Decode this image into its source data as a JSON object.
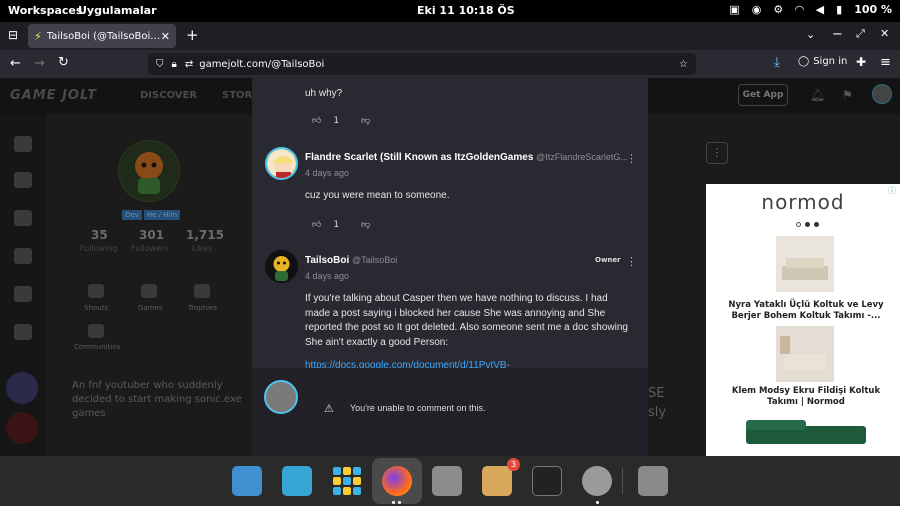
{
  "topbar": {
    "workspaces": "Workspaces",
    "apps": "Uygulamalar",
    "clock": "Eki 11  10:18 ÖS",
    "battery": "100 %"
  },
  "browser": {
    "tab_title": "TailsoBoi (@TailsoBoi) - Ga",
    "url": "gamejolt.com/@TailsoBoi",
    "signin": "Sign in"
  },
  "gamejolt": {
    "logo": "GAME JOLT",
    "discover": "DISCOVER",
    "store": "STOR",
    "get_app": "Get App",
    "tags": [
      "Dev",
      "He / Him"
    ],
    "stats": [
      {
        "value": "35",
        "label": "Following"
      },
      {
        "value": "301",
        "label": "Followers"
      },
      {
        "value": "1,715",
        "label": "Likes"
      }
    ],
    "tabs": [
      "Shouts",
      "Games",
      "Trophies",
      "Communities"
    ],
    "bio": "An fnf youtuber who suddenly decided to start making sonic.exe games",
    "side_text": [
      "SE",
      "sly"
    ]
  },
  "ad": {
    "brand": "normod",
    "items": [
      {
        "title": "Nyra Yataklı Üçlü Koltuk ve Levy Berjer Bohem Koltuk Takımı -..."
      },
      {
        "title": "Klem Modsy Ekru Fildişi Koltuk Takımı | Normod"
      }
    ]
  },
  "comments": {
    "items": [
      {
        "text": "uh why?",
        "likes": "1"
      },
      {
        "name": "Flandre Scarlet (Still Known as ItzGoldenGames",
        "handle": "@ItzFlandreScarletG...",
        "date": "4 days ago",
        "text": "cuz you were mean to someone.",
        "likes": "1"
      },
      {
        "name": "TailsoBoi",
        "handle": "@TailsoBoi",
        "badge": "Owner",
        "date": "4 days ago",
        "text": "If you're talking about Casper then we have nothing to discuss. I had made a post saying i blocked her cause She was annoying and She reported the post so It got deleted. Also someone sent me a doc showing She ain't exactly a good Person:",
        "link": "https://docs.google.com/document/d/11PvtVB-"
      }
    ],
    "footer_msg": "You're unable to comment on this."
  },
  "dock": {
    "badge_count": "3"
  },
  "colors": {
    "modal_bg": "#292931",
    "link": "#3aa8ff",
    "accent": "#4fc3e8"
  }
}
